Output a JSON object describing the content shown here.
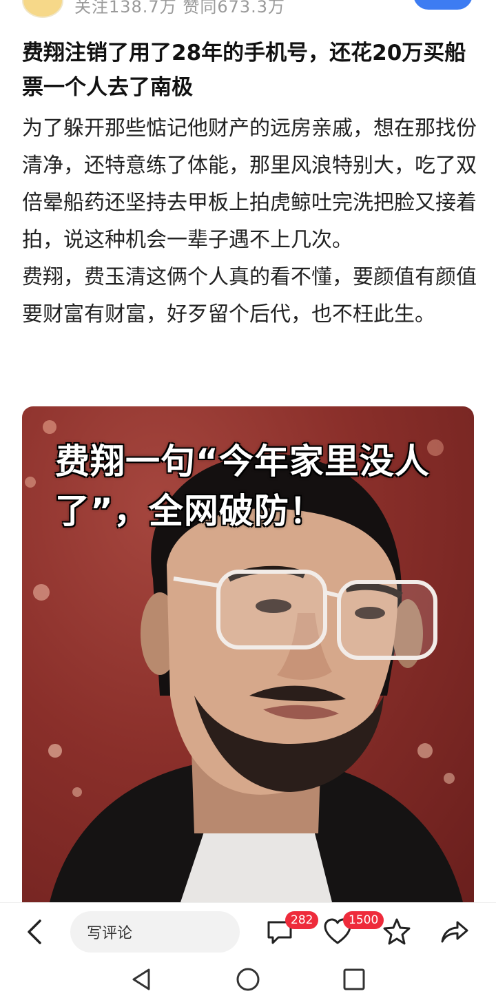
{
  "header": {
    "meta_text": "关注138.7万 赞同673.3万",
    "follow_color": "#3d7cf2"
  },
  "article": {
    "title": "费翔注销了用了28年的手机号，还花20万买船票一个人去了南极",
    "paragraphs": [
      "为了躲开那些惦记他财产的远房亲戚，想在那找份清净，还特意练了体能，那里风浪特别大，吃了双倍晕船药还坚持去甲板上拍虎鲸吐完洗把脸又接着拍，说这种机会一辈子遇不上几次。",
      "费翔，费玉清这俩个人真的看不懂，要颜值有颜值要财富有财富，好歹留个后代，也不枉此生。"
    ]
  },
  "image": {
    "caption": "费翔一句“今年家里没人了”，全网破防！",
    "description_icon": "photo-of-man-with-glasses"
  },
  "action_bar": {
    "comment_placeholder": "写评论",
    "comment_count": "282",
    "like_count": "1500",
    "badge_color": "#ee2b3b",
    "icons": [
      "back-icon",
      "comment-icon",
      "heart-icon",
      "star-icon",
      "share-icon"
    ]
  },
  "system_nav": {
    "icons": [
      "triangle-back-icon",
      "circle-home-icon",
      "square-recent-icon"
    ]
  }
}
